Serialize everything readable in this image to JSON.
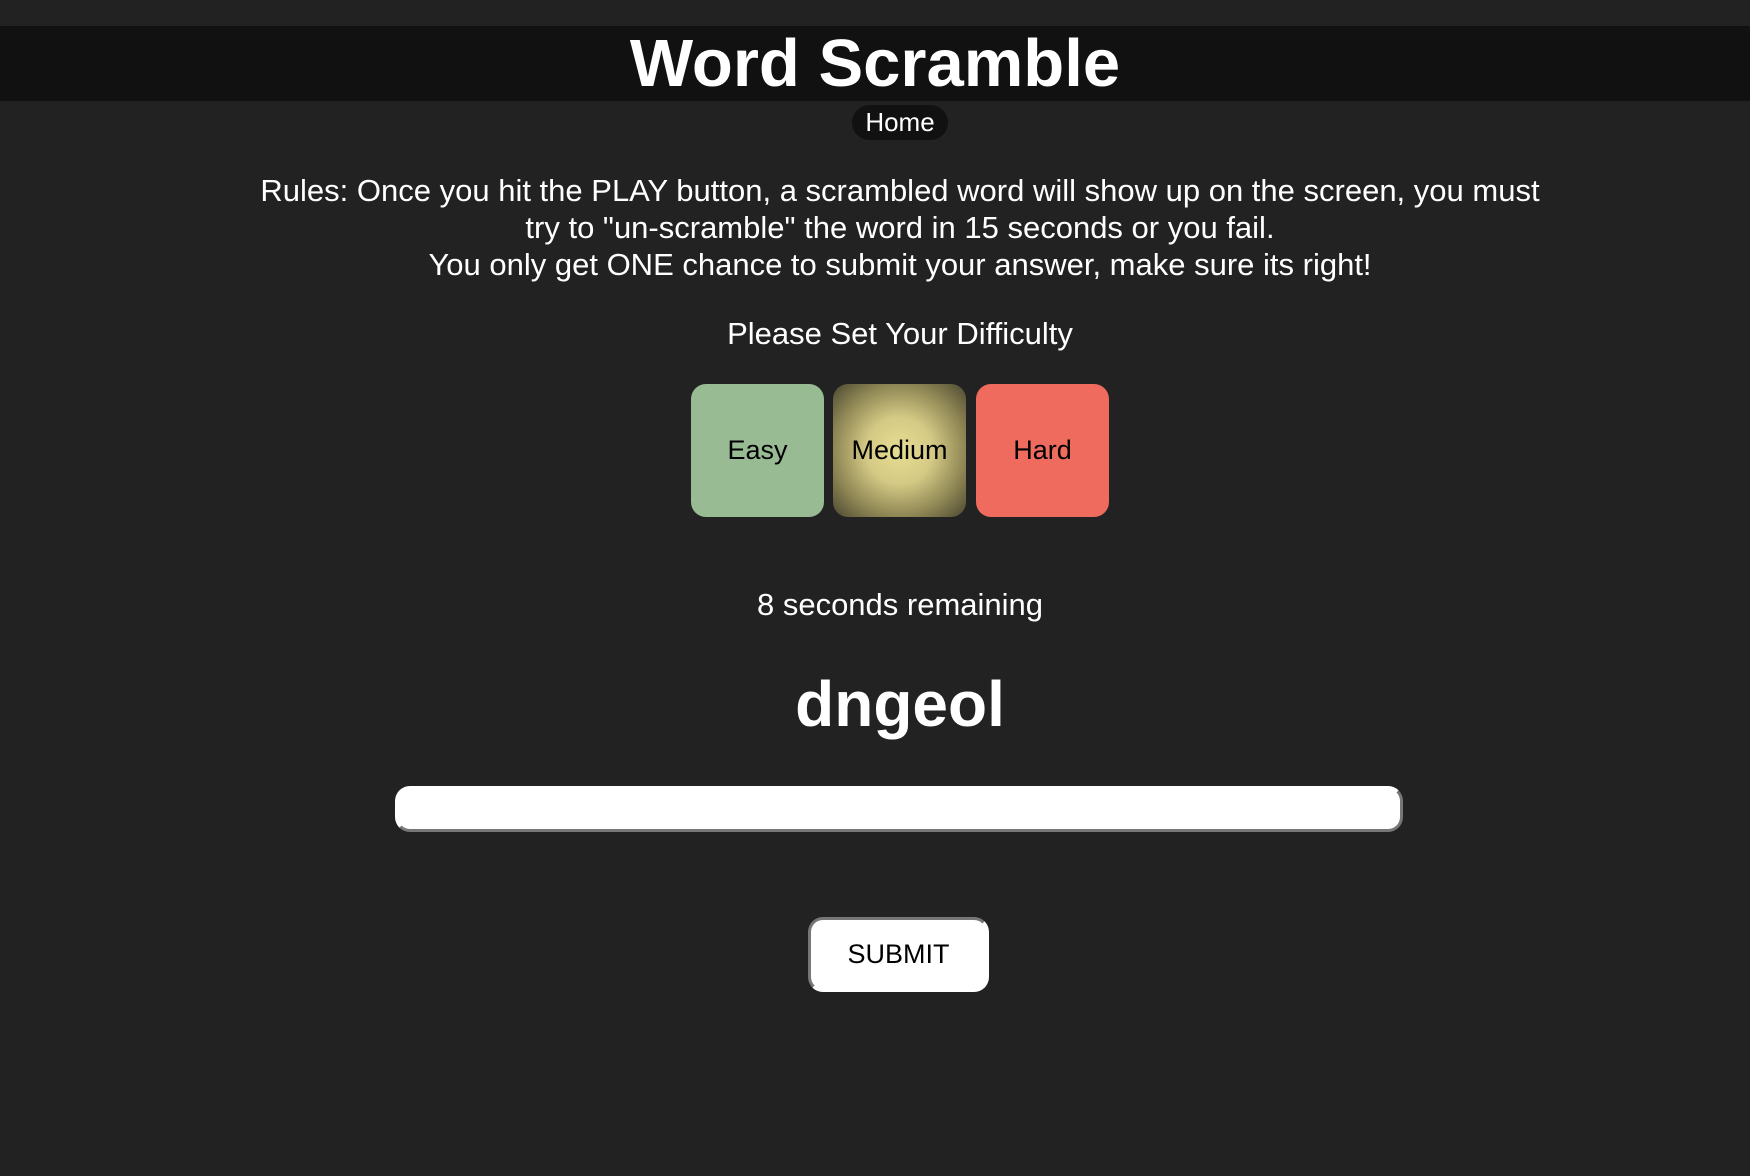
{
  "header": {
    "title": "Word Scramble",
    "home_label": "Home"
  },
  "rules": {
    "line1": "Rules: Once you hit the PLAY button, a scrambled word will show up on the screen, you must try to \"un-scramble\" the word in 15 seconds or you fail.",
    "line2": "You only get ONE chance to submit your answer, make sure its right!"
  },
  "difficulty": {
    "label": "Please Set Your Difficulty",
    "options": [
      {
        "label": "Easy",
        "color": "#98bb94"
      },
      {
        "label": "Medium",
        "color": "#e6dd92"
      },
      {
        "label": "Hard",
        "color": "#ef6b5e"
      }
    ],
    "selected": "Medium"
  },
  "game": {
    "timer_text": "8 seconds remaining",
    "scrambled_word": "dngeol",
    "answer_value": "",
    "submit_label": "SUBMIT"
  },
  "colors": {
    "background": "#222222",
    "header_bar": "#111111"
  }
}
